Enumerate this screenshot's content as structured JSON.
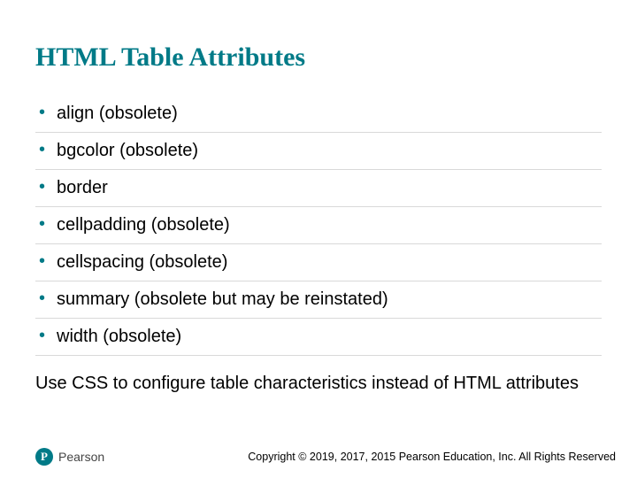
{
  "title": "HTML Table Attributes",
  "bullets": [
    "align (obsolete)",
    "bgcolor (obsolete)",
    "border",
    "cellpadding (obsolete)",
    "cellspacing (obsolete)",
    "summary (obsolete but may be reinstated)",
    "width (obsolete)"
  ],
  "note": "Use CSS to configure table characteristics instead of HTML attributes",
  "footer": {
    "brand_letter": "P",
    "brand_name": "Pearson",
    "copyright": "Copyright © 2019, 2017, 2015 Pearson Education, Inc. All Rights Reserved"
  }
}
